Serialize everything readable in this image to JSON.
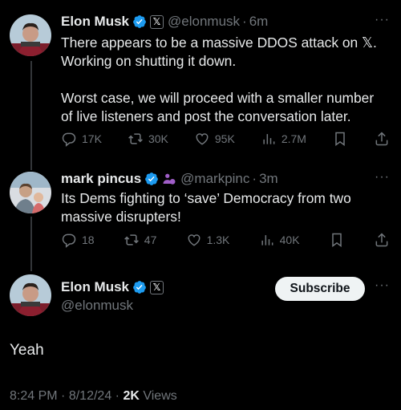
{
  "colors": {
    "background": "#000000",
    "text": "#e7e9ea",
    "muted": "#71767b",
    "verified": "#1d9bf0",
    "affiliate": "#a05ec8"
  },
  "tweets": [
    {
      "name": "Elon Musk",
      "handle": "@elonmusk",
      "sep": "·",
      "time": "6m",
      "text_lines": [
        "There appears to be a massive DDOS attack on 𝕏.",
        "Working on shutting it down.",
        "",
        "Worst case, we will proceed with a smaller number",
        "of live listeners and post the conversation later."
      ],
      "replies": "17K",
      "reposts": "30K",
      "likes": "95K",
      "views": "2.7M"
    },
    {
      "name": "mark pincus",
      "handle": "@markpinc",
      "sep": "·",
      "time": "3m",
      "text_lines": [
        "Its Dems fighting to ‘save’ Democracy from two",
        "massive disrupters!"
      ],
      "replies": "18",
      "reposts": "47",
      "likes": "1.3K",
      "views": "40K"
    }
  ],
  "main_post": {
    "name": "Elon Musk",
    "handle": "@elonmusk",
    "subscribe_label": "Subscribe",
    "text": "Yeah",
    "time": "8:24 PM",
    "sep1": "·",
    "date": "8/12/24",
    "sep2": "·",
    "views_count": "2K",
    "views_label": "Views"
  },
  "icons": [
    "verified-icon",
    "x-logo-icon",
    "affiliate-badge-icon",
    "reply-icon",
    "repost-icon",
    "like-icon",
    "views-icon",
    "bookmark-icon",
    "share-icon",
    "more-icon"
  ]
}
